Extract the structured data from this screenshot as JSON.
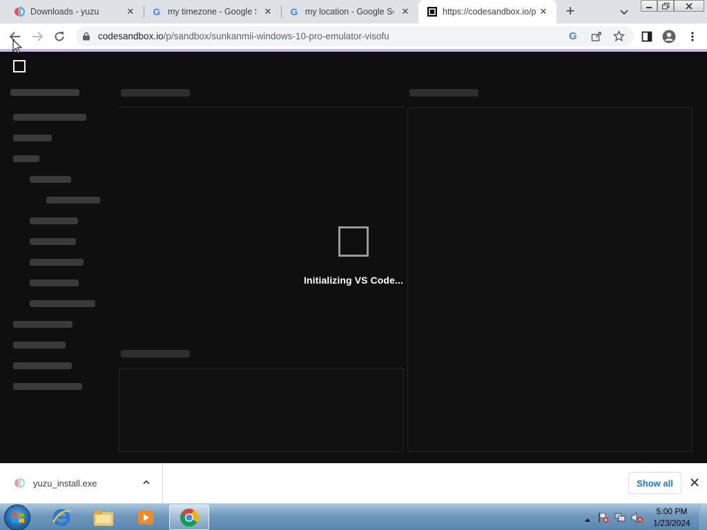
{
  "browser": {
    "tabs": [
      {
        "title": "Downloads - yuzu",
        "icon": "yuzu-icon",
        "active": false
      },
      {
        "title": "my timezone - Google Se",
        "icon": "google-icon",
        "active": false
      },
      {
        "title": "my location - Google Sea",
        "icon": "google-icon",
        "active": false
      },
      {
        "title": "https://codesandbox.io/p",
        "icon": "codesandbox-icon",
        "active": true
      }
    ],
    "url_host": "codesandbox.io",
    "url_path": "/p/sandbox/sunkanmii-windows-10-pro-emulator-visofu"
  },
  "page": {
    "loading_text": "Initializing VS Code..."
  },
  "downloads": {
    "file_name": "yuzu_install.exe",
    "show_all_label": "Show all"
  },
  "taskbar": {
    "apps": [
      "internet-explorer-icon",
      "file-explorer-icon",
      "media-player-icon",
      "chrome-icon"
    ],
    "time": "5:00 PM",
    "date": "1/23/2024"
  },
  "colors": {
    "page_background": "#0f0f0f",
    "skeleton": "#3a3a3a",
    "load_bar": "#c8b8ee",
    "link_blue": "#1a73e8"
  }
}
